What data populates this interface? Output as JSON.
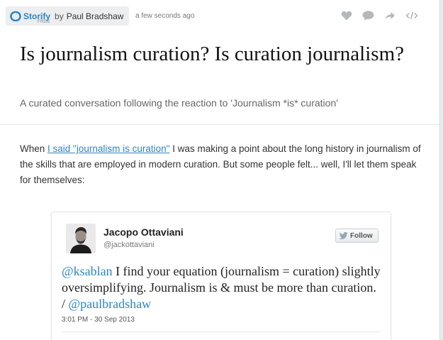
{
  "header": {
    "brand": "Storify",
    "brand_tier": "FREE",
    "by": "by",
    "author": "Paul Bradshaw",
    "timestamp": "a few seconds ago",
    "actions": [
      "heart-icon",
      "comment-icon",
      "share-icon",
      "embed-icon"
    ]
  },
  "story": {
    "title": "Is journalism curation? Is curation journalism?",
    "subtitle": "A curated conversation following the reaction to 'Journalism *is* curation'",
    "intro_before": "When ",
    "intro_link": "I said \"journalism is curation\"",
    "intro_after": " I was making a point about the long history in journalism of the skills that are employed in modern curation. But some people felt... well, I'll let them speak for themselves:"
  },
  "tweet": {
    "name": "Jacopo Ottaviani",
    "handle": "@jackottaviani",
    "follow_label": "Follow",
    "mention1": "@ksablan",
    "text": " I find your equation (journalism = curation) slightly oversimplifying. Journalism is & must be more than curation. / ",
    "mention2": "@paulbradshaw",
    "date": "3:01 PM - 30 Sep 2013"
  },
  "colors": {
    "accent": "#2b86c5",
    "icon": "#b3b8bd"
  }
}
